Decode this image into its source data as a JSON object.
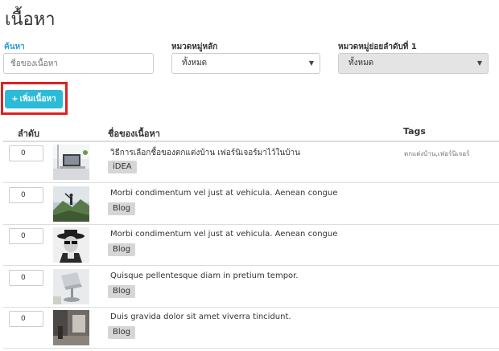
{
  "page": {
    "title": "เนื้อหา"
  },
  "filters": {
    "search": {
      "label": "ค้นหา",
      "placeholder": "ชื่อของเนื้อหา"
    },
    "main_category": {
      "label": "หมวดหมู่หลัก",
      "value": "ทั้งหมด"
    },
    "sub_category": {
      "label": "หมวดหมู่ย่อยลำดับที่ 1",
      "value": "ทั้งหมด"
    }
  },
  "toolbar": {
    "add_label": "เพิ่มเนื้อหา",
    "add_icon": "plus-icon"
  },
  "table": {
    "headers": {
      "order": "ลำดับ",
      "name": "ชื่อของเนื้อหา",
      "tags": "Tags"
    },
    "rows": [
      {
        "order": "0",
        "title": "วิธีการเลือกชื้อของตกแต่งบ้าน เฟอร์นิเจอร์มาไว้ในบ้าน",
        "category": "iDEA",
        "tags": "ตกแต่งบ้าน,เฟอร์นิเจอร์",
        "thumb": "desk-laptop"
      },
      {
        "order": "0",
        "title": "Morbi condimentum vel just at vehicula. Aenean congue",
        "category": "Blog",
        "tags": "",
        "thumb": "mountain-person"
      },
      {
        "order": "0",
        "title": "Morbi condimentum vel just at vehicula. Aenean congue",
        "category": "Blog",
        "tags": "",
        "thumb": "hat-person"
      },
      {
        "order": "0",
        "title": "Quisque pellentesque diam in pretium tempor.",
        "category": "Blog",
        "tags": "",
        "thumb": "lamp"
      },
      {
        "order": "0",
        "title": "Duis gravida dolor sit amet viverra tincidunt.",
        "category": "Blog",
        "tags": "",
        "thumb": "interior"
      }
    ]
  }
}
